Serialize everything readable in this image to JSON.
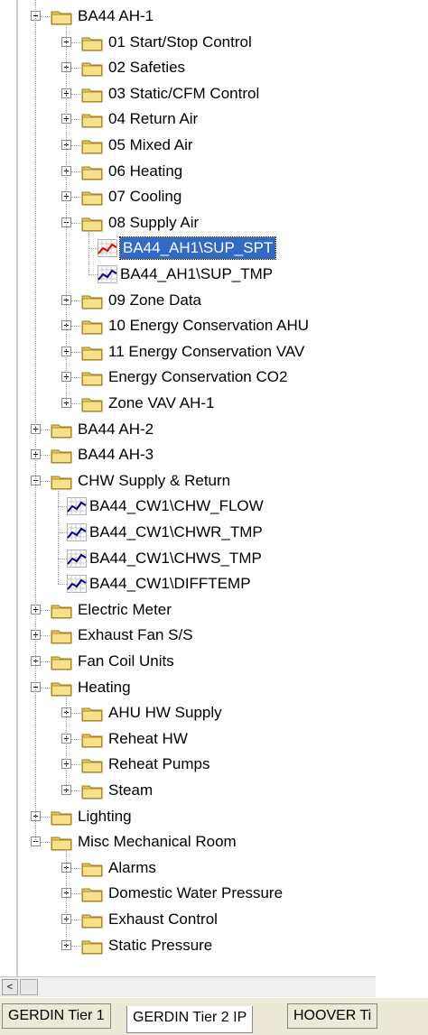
{
  "tree": [
    {
      "label": "BA44 AH-1",
      "kind": "folder",
      "level": 0,
      "expander": "minus"
    },
    {
      "label": "01 Start/Stop  Control",
      "kind": "folder",
      "level": 1,
      "expander": "plus"
    },
    {
      "label": "02 Safeties",
      "kind": "folder",
      "level": 1,
      "expander": "plus"
    },
    {
      "label": "03 Static/CFM Control",
      "kind": "folder",
      "level": 1,
      "expander": "plus"
    },
    {
      "label": "04 Return Air",
      "kind": "folder",
      "level": 1,
      "expander": "plus"
    },
    {
      "label": "05 Mixed Air",
      "kind": "folder",
      "level": 1,
      "expander": "plus"
    },
    {
      "label": "06 Heating",
      "kind": "folder",
      "level": 1,
      "expander": "plus"
    },
    {
      "label": "07 Cooling",
      "kind": "folder",
      "level": 1,
      "expander": "plus"
    },
    {
      "label": "08 Supply Air",
      "kind": "folder",
      "level": 1,
      "expander": "minus"
    },
    {
      "label": "BA44_AH1\\SUP_SPT",
      "kind": "trend-red",
      "level": 2,
      "selected": true
    },
    {
      "label": "BA44_AH1\\SUP_TMP",
      "kind": "trend-blue",
      "level": 2
    },
    {
      "label": "09 Zone Data",
      "kind": "folder",
      "level": 1,
      "expander": "plus"
    },
    {
      "label": "10 Energy Conservation AHU",
      "kind": "folder",
      "level": 1,
      "expander": "plus"
    },
    {
      "label": "11 Energy Conservation VAV",
      "kind": "folder",
      "level": 1,
      "expander": "plus"
    },
    {
      "label": "Energy Conservation CO2",
      "kind": "folder",
      "level": 1,
      "expander": "plus"
    },
    {
      "label": "Zone VAV AH-1",
      "kind": "folder",
      "level": 1,
      "expander": "plus"
    },
    {
      "label": "BA44 AH-2",
      "kind": "folder",
      "level": 0,
      "expander": "plus"
    },
    {
      "label": "BA44 AH-3",
      "kind": "folder",
      "level": 0,
      "expander": "plus"
    },
    {
      "label": "CHW Supply & Return",
      "kind": "folder",
      "level": 0,
      "expander": "minus"
    },
    {
      "label": "BA44_CW1\\CHW_FLOW",
      "kind": "trend-blue",
      "level": 1
    },
    {
      "label": "BA44_CW1\\CHWR_TMP",
      "kind": "trend-blue",
      "level": 1
    },
    {
      "label": "BA44_CW1\\CHWS_TMP",
      "kind": "trend-blue",
      "level": 1
    },
    {
      "label": "BA44_CW1\\DIFFTEMP",
      "kind": "trend-blue",
      "level": 1
    },
    {
      "label": "Electric Meter",
      "kind": "folder",
      "level": 0,
      "expander": "plus"
    },
    {
      "label": "Exhaust Fan S/S",
      "kind": "folder",
      "level": 0,
      "expander": "plus"
    },
    {
      "label": "Fan Coil Units",
      "kind": "folder",
      "level": 0,
      "expander": "plus"
    },
    {
      "label": "Heating",
      "kind": "folder",
      "level": 0,
      "expander": "minus"
    },
    {
      "label": "AHU HW Supply",
      "kind": "folder",
      "level": 1,
      "expander": "plus"
    },
    {
      "label": "Reheat HW",
      "kind": "folder",
      "level": 1,
      "expander": "plus"
    },
    {
      "label": "Reheat Pumps",
      "kind": "folder",
      "level": 1,
      "expander": "plus"
    },
    {
      "label": "Steam",
      "kind": "folder",
      "level": 1,
      "expander": "plus"
    },
    {
      "label": "Lighting",
      "kind": "folder",
      "level": 0,
      "expander": "plus"
    },
    {
      "label": "Misc Mechanical Room",
      "kind": "folder",
      "level": 0,
      "expander": "minus"
    },
    {
      "label": "Alarms",
      "kind": "folder",
      "level": 1,
      "expander": "plus"
    },
    {
      "label": "Domestic Water Pressure",
      "kind": "folder",
      "level": 1,
      "expander": "plus"
    },
    {
      "label": "Exhaust Control",
      "kind": "folder",
      "level": 1,
      "expander": "plus"
    },
    {
      "label": "Static Pressure",
      "kind": "folder",
      "level": 1,
      "expander": "plus"
    }
  ],
  "scrollbar": {
    "left_arrow": "<"
  },
  "tabs": [
    {
      "label": "GERDIN Tier 1",
      "active": false
    },
    {
      "label": "GERDIN Tier 2 IP",
      "active": true
    },
    {
      "label": "HOOVER Ti",
      "active": false
    }
  ],
  "colors": {
    "selection": "#316ac5",
    "folder": "#f0d878",
    "trend_red": "#e00000",
    "trend_blue": "#000080"
  }
}
